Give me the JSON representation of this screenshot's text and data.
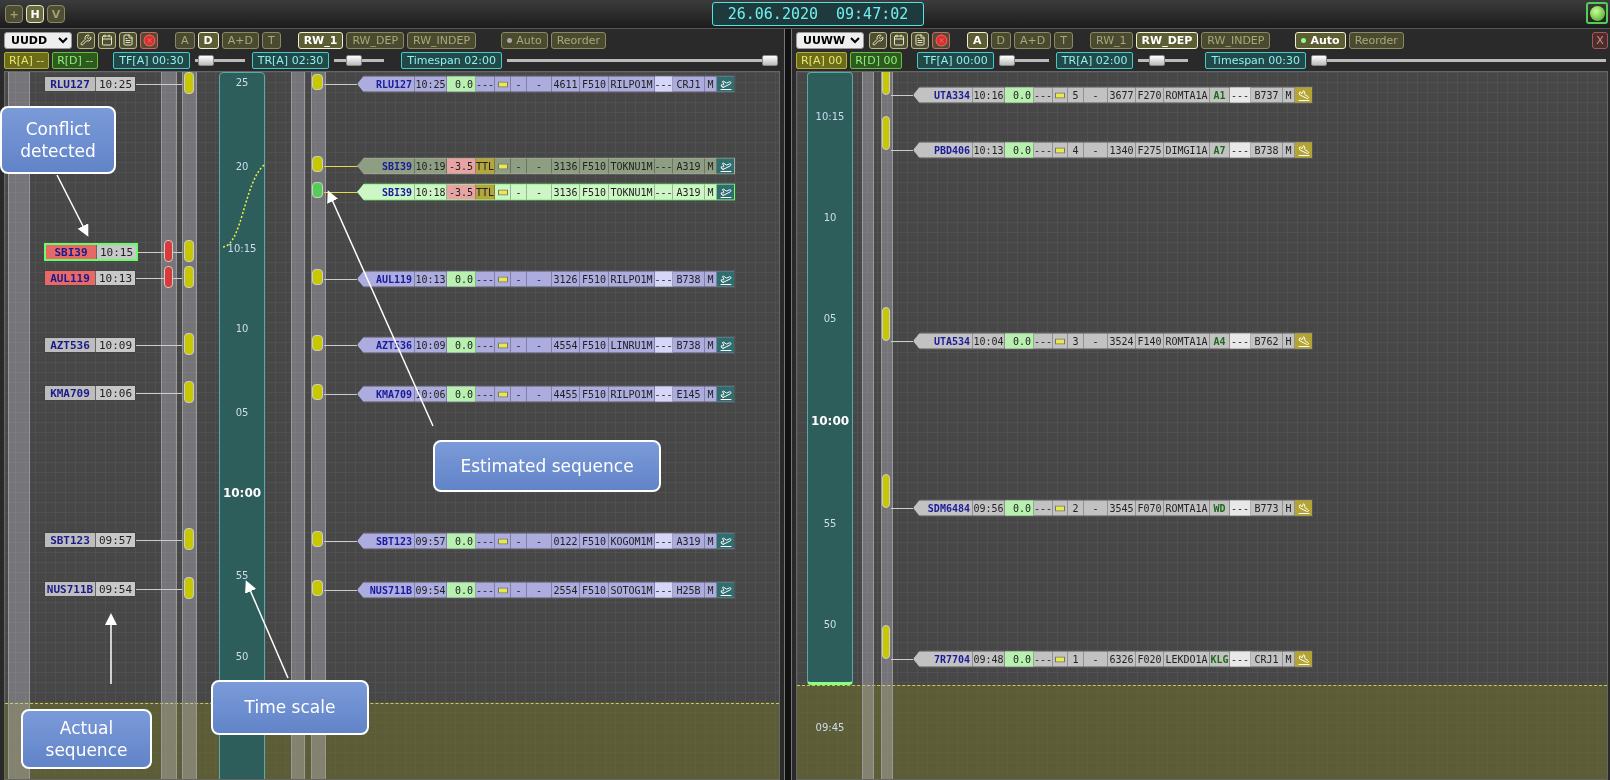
{
  "top_bar": {
    "buttons": [
      {
        "label": "+",
        "selected": false
      },
      {
        "label": "H",
        "selected": true
      },
      {
        "label": "V",
        "selected": false
      }
    ],
    "date": "26.06.2020",
    "time": "09:47:02",
    "status_light": {
      "on": true
    }
  },
  "panels": [
    {
      "kind": "arrival",
      "airport": "UUDD",
      "modes": [
        {
          "label": "A",
          "selected": false
        },
        {
          "label": "D",
          "selected": true
        },
        {
          "label": "A+D",
          "selected": false
        },
        {
          "label": "T",
          "selected": false
        }
      ],
      "runways": [
        {
          "label": "RW_1",
          "selected": true
        },
        {
          "label": "RW_DEP",
          "selected": false
        },
        {
          "label": "RW_INDEP",
          "selected": false
        }
      ],
      "auto": {
        "label": "Auto",
        "on": false
      },
      "reorder": "Reorder",
      "counters": [
        {
          "label": "R[A] --",
          "kind": "arrival"
        },
        {
          "label": "R[D] --",
          "kind": "departure"
        }
      ],
      "sliders": [
        {
          "label": "TF[A] 00:30",
          "level": 0.1,
          "kind": "short"
        },
        {
          "label": "TR[A] 02:30",
          "level": 0.35,
          "kind": "short"
        },
        {
          "label": "Timespan 02:00",
          "level": 1,
          "kind": "long"
        }
      ],
      "scale_labels": [
        {
          "text": "25",
          "major": false
        },
        {
          "text": "20",
          "major": false
        },
        {
          "text": "10:15",
          "major": false
        },
        {
          "text": "10",
          "major": false
        },
        {
          "text": "05",
          "major": false
        },
        {
          "text": "10:00",
          "major": true
        },
        {
          "text": "55",
          "major": false
        },
        {
          "text": "50",
          "major": false
        }
      ],
      "actual_sequence": [
        {
          "callsign": "RLU127",
          "time": "10:25",
          "alert": false,
          "selected": false
        },
        {
          "callsign": "SBI39",
          "time": "10:15",
          "alert": true,
          "selected": true
        },
        {
          "callsign": "AUL119",
          "time": "10:13",
          "alert": true,
          "selected": false
        },
        {
          "callsign": "AZT536",
          "time": "10:09",
          "alert": false,
          "selected": false
        },
        {
          "callsign": "KMA709",
          "time": "10:06",
          "alert": false,
          "selected": false
        },
        {
          "callsign": "SBT123",
          "time": "09:57",
          "alert": false,
          "selected": false
        },
        {
          "callsign": "NUS711B",
          "time": "09:54",
          "alert": false,
          "selected": false
        }
      ],
      "strips": [
        {
          "ghost": false,
          "selected": false,
          "callsign": "RLU127",
          "time": "10:25",
          "delta": "0.0",
          "delta_alert": false,
          "column_4": "---",
          "column_4_highlighted": false,
          "order": "-",
          "column_7": "-",
          "squawk": "4611",
          "level": "F510",
          "route": "RILPO1M",
          "column_11": "---",
          "type": "CRJ1",
          "wake": "M"
        },
        {
          "ghost": true,
          "selected": false,
          "callsign": "SBI39",
          "time": "10:19",
          "delta": "-3.5",
          "delta_alert": true,
          "column_4": "TTL",
          "column_4_highlighted": true,
          "order": "-",
          "column_7": "-",
          "squawk": "3136",
          "level": "F510",
          "route": "TOKNU1M",
          "column_11": "---",
          "type": "A319",
          "wake": "M"
        },
        {
          "ghost": false,
          "selected": true,
          "callsign": "SBI39",
          "time": "10:18",
          "delta": "-3.5",
          "delta_alert": true,
          "column_4": "TTL",
          "column_4_highlighted": true,
          "order": "-",
          "column_7": "-",
          "squawk": "3136",
          "level": "F510",
          "route": "TOKNU1M",
          "column_11": "---",
          "type": "A319",
          "wake": "M"
        },
        {
          "ghost": false,
          "selected": false,
          "callsign": "AUL119",
          "time": "10:13",
          "delta": "0.0",
          "delta_alert": false,
          "column_4": "---",
          "column_4_highlighted": false,
          "order": "-",
          "column_7": "-",
          "squawk": "3126",
          "level": "F510",
          "route": "RILPO1M",
          "column_11": "---",
          "type": "B738",
          "wake": "M"
        },
        {
          "ghost": false,
          "selected": false,
          "callsign": "AZT536",
          "time": "10:09",
          "delta": "0.0",
          "delta_alert": false,
          "column_4": "---",
          "column_4_highlighted": false,
          "order": "-",
          "column_7": "-",
          "squawk": "4554",
          "level": "F510",
          "route": "LINRU1M",
          "column_11": "---",
          "type": "B738",
          "wake": "M"
        },
        {
          "ghost": false,
          "selected": false,
          "callsign": "KMA709",
          "time": "10:06",
          "delta": "0.0",
          "delta_alert": false,
          "column_4": "---",
          "column_4_highlighted": false,
          "order": "-",
          "column_7": "-",
          "squawk": "4455",
          "level": "F510",
          "route": "RILPO1M",
          "column_11": "---",
          "type": "E145",
          "wake": "M"
        },
        {
          "ghost": false,
          "selected": false,
          "callsign": "SBT123",
          "time": "09:57",
          "delta": "0.0",
          "delta_alert": false,
          "column_4": "---",
          "column_4_highlighted": false,
          "order": "-",
          "column_7": "-",
          "squawk": "0122",
          "level": "F510",
          "route": "KOGOM1M",
          "column_11": "---",
          "type": "A319",
          "wake": "M"
        },
        {
          "ghost": false,
          "selected": false,
          "callsign": "NUS711B",
          "time": "09:54",
          "delta": "0.0",
          "delta_alert": false,
          "column_4": "---",
          "column_4_highlighted": false,
          "order": "-",
          "column_7": "-",
          "squawk": "2554",
          "level": "F510",
          "route": "SOTOG1M",
          "column_11": "---",
          "type": "H25B",
          "wake": "M"
        }
      ]
    },
    {
      "kind": "departure",
      "airport": "UUWW",
      "modes": [
        {
          "label": "A",
          "selected": true
        },
        {
          "label": "D",
          "selected": false
        },
        {
          "label": "A+D",
          "selected": false
        },
        {
          "label": "T",
          "selected": false
        }
      ],
      "runways": [
        {
          "label": "RW_1",
          "selected": false
        },
        {
          "label": "RW_DEP",
          "selected": true
        },
        {
          "label": "RW_INDEP",
          "selected": false
        }
      ],
      "auto": {
        "label": "Auto",
        "on": true
      },
      "reorder": "Reorder",
      "close": "X",
      "counters": [
        {
          "label": "R[A] 00",
          "kind": "arrival"
        },
        {
          "label": "R[D] 00",
          "kind": "departure"
        }
      ],
      "sliders": [
        {
          "label": "TF[A] 00:00",
          "level": 0,
          "kind": "short"
        },
        {
          "label": "TR[A] 02:00",
          "level": 0.3,
          "kind": "short"
        },
        {
          "label": "Timespan 00:30",
          "level": 0,
          "kind": "long"
        }
      ],
      "scale_labels": [
        {
          "text": "10:15",
          "major": false
        },
        {
          "text": "10",
          "major": false
        },
        {
          "text": "05",
          "major": false
        },
        {
          "text": "10:00",
          "major": true
        },
        {
          "text": "55",
          "major": false
        },
        {
          "text": "50",
          "major": false
        },
        {
          "text": "09:45",
          "major": false
        }
      ],
      "strips": [
        {
          "ghost": false,
          "selected": false,
          "callsign": "UTA334",
          "time": "10:16",
          "delta": "0.0",
          "delta_alert": false,
          "column_4": "---",
          "column_4_highlighted": false,
          "order": "5",
          "column_7": "-",
          "squawk": "3677",
          "level": "F270",
          "route": "ROMTA1A",
          "stand": "A1",
          "column_11": "---",
          "type": "B737",
          "wake": "M"
        },
        {
          "ghost": false,
          "selected": false,
          "callsign": "PBD406",
          "time": "10:13",
          "delta": "0.0",
          "delta_alert": false,
          "column_4": "---",
          "column_4_highlighted": false,
          "order": "4",
          "column_7": "-",
          "squawk": "1340",
          "level": "F275",
          "route": "DIMGI1A",
          "stand": "A7",
          "column_11": "---",
          "type": "B738",
          "wake": "M"
        },
        {
          "ghost": false,
          "selected": false,
          "callsign": "UTA534",
          "time": "10:04",
          "delta": "0.0",
          "delta_alert": false,
          "column_4": "---",
          "column_4_highlighted": false,
          "order": "3",
          "column_7": "-",
          "squawk": "3524",
          "level": "F140",
          "route": "ROMTA1A",
          "stand": "A4",
          "column_11": "---",
          "type": "B762",
          "wake": "H"
        },
        {
          "ghost": false,
          "selected": false,
          "callsign": "SDM6484",
          "time": "09:56",
          "delta": "0.0",
          "delta_alert": false,
          "column_4": "---",
          "column_4_highlighted": false,
          "order": "2",
          "column_7": "-",
          "squawk": "3545",
          "level": "F070",
          "route": "ROMTA1A",
          "stand": "WD",
          "column_11": "---",
          "type": "B773",
          "wake": "H"
        },
        {
          "ghost": false,
          "selected": false,
          "callsign": "7R7704",
          "time": "09:48",
          "delta": "0.0",
          "delta_alert": false,
          "column_4": "---",
          "column_4_highlighted": false,
          "order": "1",
          "column_7": "-",
          "squawk": "6326",
          "level": "F020",
          "route": "LEKDO1A",
          "stand": "KLG",
          "column_11": "---",
          "type": "CRJ1",
          "wake": "M"
        }
      ]
    }
  ],
  "callouts": [
    {
      "text": "Conflict detected"
    },
    {
      "text": "Estimated sequence"
    },
    {
      "text": "Time scale"
    },
    {
      "text": "Actual sequence"
    }
  ]
}
